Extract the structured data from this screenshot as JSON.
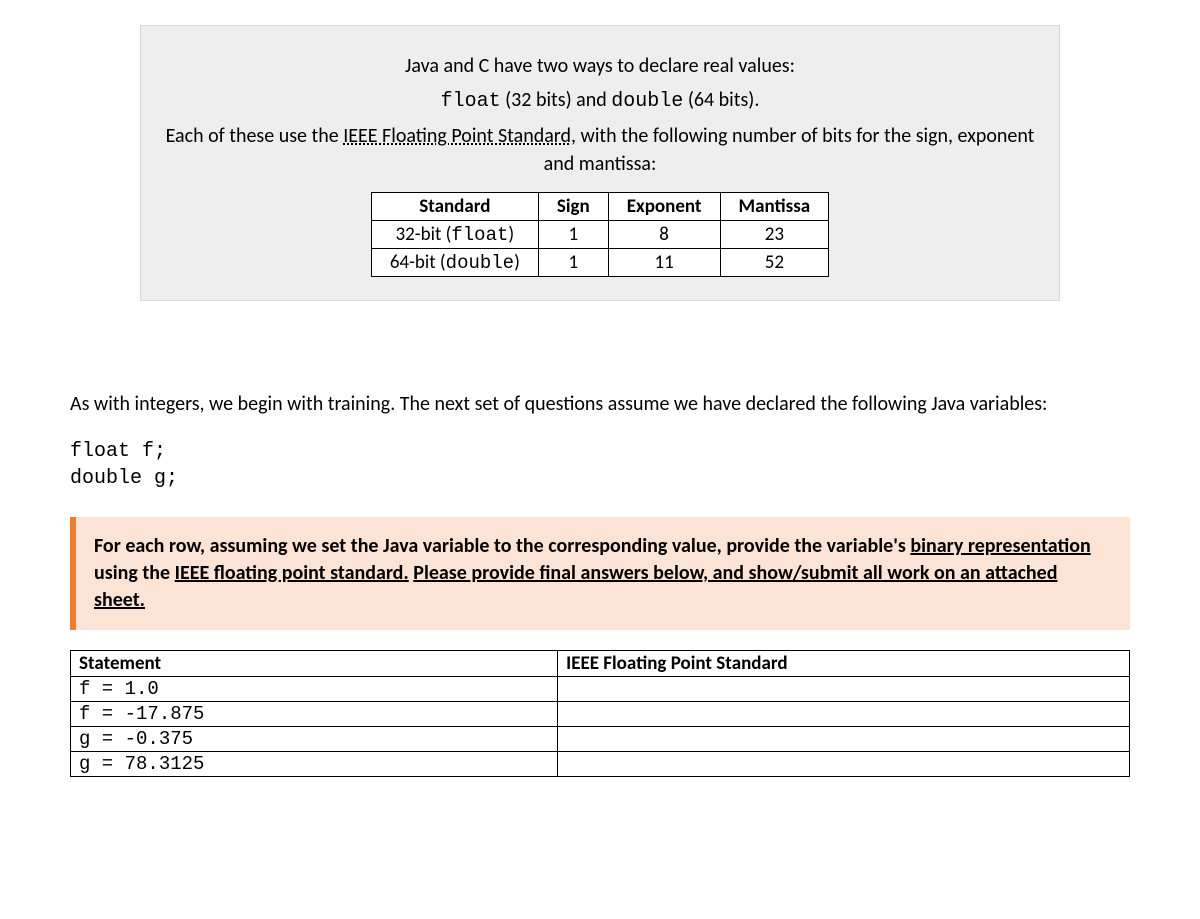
{
  "info": {
    "line1_pre": "Java and C have two ways to declare real values:",
    "line2_code1": "float",
    "line2_mid": " (32 bits) and ",
    "line2_code2": "double",
    "line2_post": " (64 bits).",
    "line3_pre": "Each of these use the ",
    "line3_link": "IEEE Floating Point Standard",
    "line3_post": ", with the following number of bits for the sign, exponent and mantissa:"
  },
  "bits_headers": [
    "Standard",
    "Sign",
    "Exponent",
    "Mantissa"
  ],
  "bits_rows": [
    {
      "label_pre": "32-bit (",
      "label_code": "float",
      "label_post": ")",
      "sign": "1",
      "exp": "8",
      "mant": "23"
    },
    {
      "label_pre": "64-bit (",
      "label_code": "double",
      "label_post": ")",
      "sign": "1",
      "exp": "11",
      "mant": "52"
    }
  ],
  "paragraph": "As with integers, we begin with training.  The next set of questions assume we have declared the following Java variables:",
  "code": {
    "line1": "float f;",
    "line2": "double g;"
  },
  "callout": {
    "pre": "For each row, assuming we set the Java variable to the corresponding value, provide the variable's ",
    "u1": "binary representation",
    "mid": " using the ",
    "u2": "IEEE floating point standard.",
    "gap": "  ",
    "u3": "Please provide final answers below, and show/submit all work on an attached sheet."
  },
  "answer_headers": [
    "Statement",
    "IEEE Floating Point Standard"
  ],
  "answer_rows": [
    {
      "stmt": "f = 1.0",
      "ans": ""
    },
    {
      "stmt": "f = -17.875",
      "ans": ""
    },
    {
      "stmt": "g = -0.375",
      "ans": ""
    },
    {
      "stmt": "g = 78.3125",
      "ans": ""
    }
  ]
}
